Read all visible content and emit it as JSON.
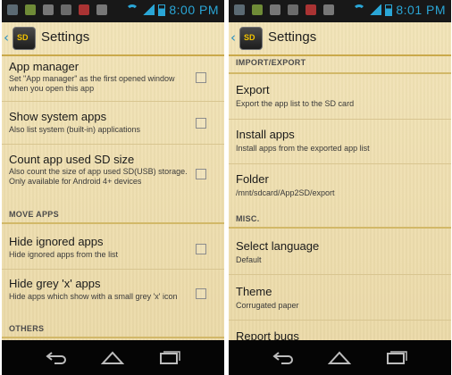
{
  "left": {
    "status": {
      "time": "8:00 PM",
      "left_icons": [
        "60",
        "photo",
        "game",
        "calendar",
        "mail",
        "notification"
      ]
    },
    "actionbar": {
      "title": "Settings"
    },
    "items": [
      {
        "title": "App manager",
        "summary": "Set \"App manager\" as the first opened window when you open this app"
      },
      {
        "title": "Show system apps",
        "summary": "Also list system (built-in) applications"
      },
      {
        "title": "Count app used SD size",
        "summary": "Also count the size of app used SD(USB) storage. Only available for Android 4+ devices"
      }
    ],
    "category_move": "MOVE APPS",
    "items2": [
      {
        "title": "Hide ignored apps",
        "summary": "Hide ignored apps from the list"
      },
      {
        "title": "Hide grey 'x' apps",
        "summary": "Hide apps which show with a small grey 'x' icon"
      }
    ],
    "category_others": "OTHERS"
  },
  "right": {
    "status": {
      "time": "8:01 PM"
    },
    "actionbar": {
      "title": "Settings"
    },
    "category_import": "IMPORT/EXPORT",
    "items": [
      {
        "title": "Export",
        "summary": "Export the app list to the SD card"
      },
      {
        "title": "Install apps",
        "summary": "Install apps from the exported app list"
      },
      {
        "title": "Folder",
        "summary": "/mnt/sdcard/App2SD/export"
      }
    ],
    "category_misc": "MISC.",
    "items2": [
      {
        "title": "Select language",
        "summary": "Default"
      },
      {
        "title": "Theme",
        "summary": "Corrugated paper"
      },
      {
        "title": "Report bugs",
        "summary": ""
      }
    ]
  },
  "colors": {
    "accent": "#2aa6d6",
    "paper": "#efe0b2",
    "divider": "#d2b868"
  },
  "icons": {
    "back": "back-arrow-icon",
    "home": "home-icon",
    "recent": "recent-apps-icon",
    "logo": "sd-card-logo-icon"
  }
}
